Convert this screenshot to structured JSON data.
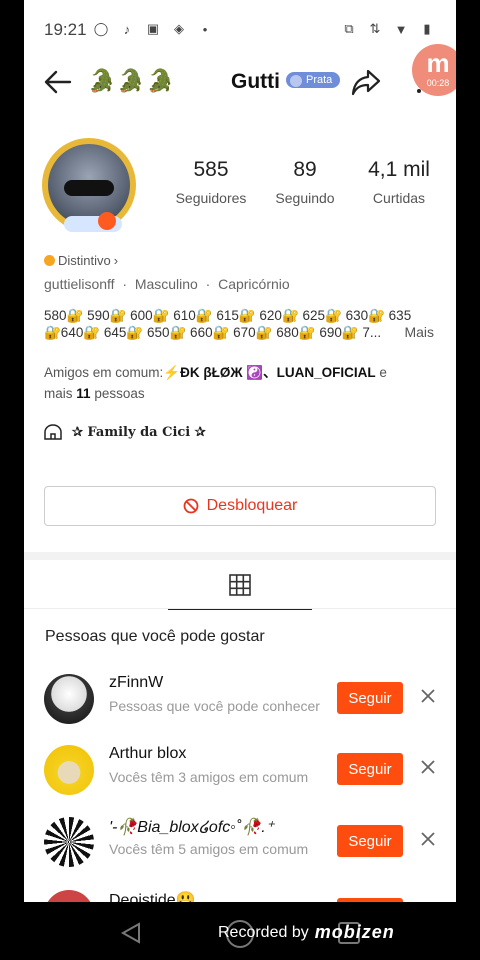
{
  "status_bar": {
    "time": "19:21"
  },
  "header": {
    "emojis": "🐊🐊🐊",
    "name": "Gutti",
    "rank": "Prata",
    "recorder_time": "00:28"
  },
  "stats": [
    {
      "value": "585",
      "label": "Seguidores"
    },
    {
      "value": "89",
      "label": "Seguindo"
    },
    {
      "value": "4,1 mil",
      "label": "Curtidas"
    }
  ],
  "profile": {
    "badge_label": "Distintivo",
    "username": "guttielisonff",
    "gender": "Masculino",
    "sign": "Capricórnio",
    "separator": "·",
    "bio_line1": "580🔐 590🔐 600🔐 610🔐 615🔐 620🔐 625🔐 630🔐 635",
    "bio_line2": "🔐640🔐 645🔐 650🔐 660🔐 670🔐 680🔐 690🔐 7...",
    "bio_more": "Mais",
    "friends_prefix": "Amigos em comum:",
    "friends_names": "⚡ƉK   βŁØЖ ☯️、LUAN_OFICIAL",
    "friends_and": "e",
    "friends_more_prefix": "mais",
    "friends_count": "11",
    "friends_suffix": "pessoas",
    "family": "✰ Family da Cici ✰"
  },
  "actions": {
    "unblock": "Desbloquear"
  },
  "suggestions": {
    "title": "Pessoas que você pode gostar",
    "follow_label": "Seguir",
    "items": [
      {
        "name": "zFinnW",
        "sub": "Pessoas que você pode conhecer"
      },
      {
        "name": "Arthur blox",
        "sub": "Vocês têm 3 amigos em comum"
      },
      {
        "name": "'-🥀Bia_blox໒ofc◦˚🥀.⁺",
        "sub": "Vocês têm 5 amigos em comum"
      },
      {
        "name": "Deoistide😃",
        "sub": ""
      }
    ]
  },
  "footer": {
    "recorded_by": "Recorded by",
    "brand": "mobizen"
  },
  "colors": {
    "accent": "#ff4d10",
    "unblock": "#e8361e",
    "rank": "#6f8dd8"
  }
}
